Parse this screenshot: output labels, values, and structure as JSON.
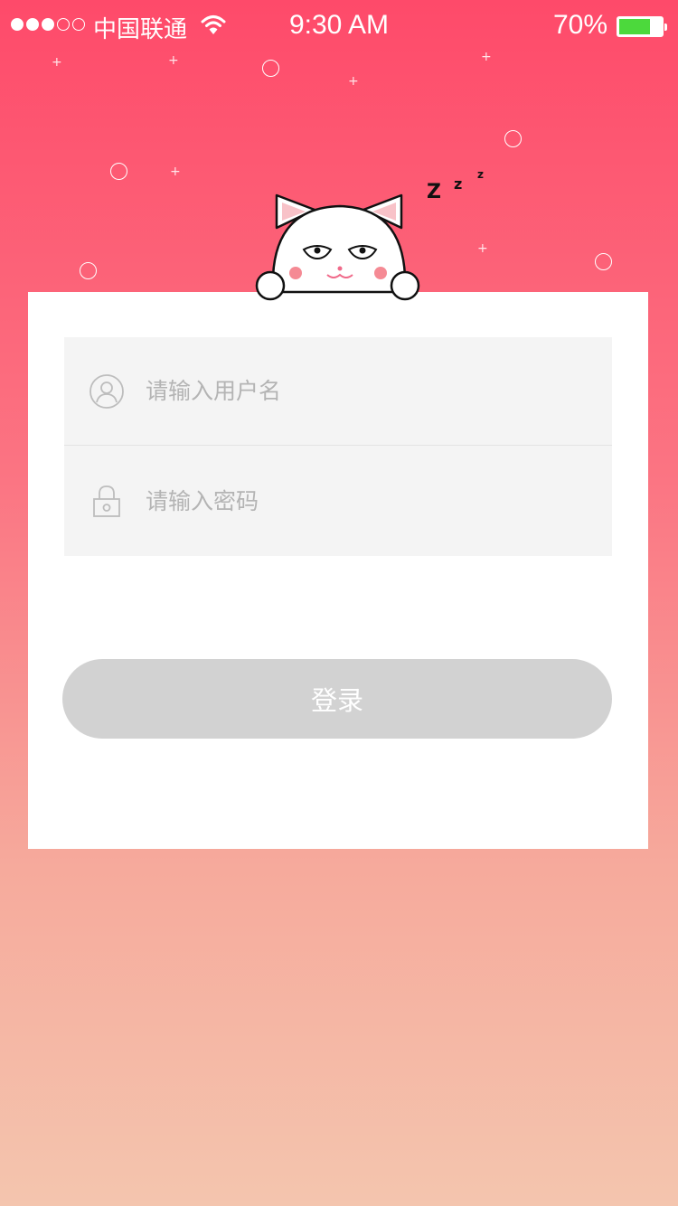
{
  "status_bar": {
    "carrier": "中国联通",
    "time": "9:30 AM",
    "battery_percent": "70%",
    "battery_level": 0.7,
    "signal_bars_filled": 3,
    "signal_bars_total": 5
  },
  "login": {
    "username_placeholder": "请输入用户名",
    "password_placeholder": "请输入密码",
    "login_label": "登录"
  },
  "mascot": {
    "snore_text": "Z z z"
  },
  "colors": {
    "gradient_top": "#fe4a6a",
    "gradient_bottom": "#f4c5ae",
    "button_disabled": "#d2d2d2",
    "battery_fill": "#4cd93c"
  }
}
